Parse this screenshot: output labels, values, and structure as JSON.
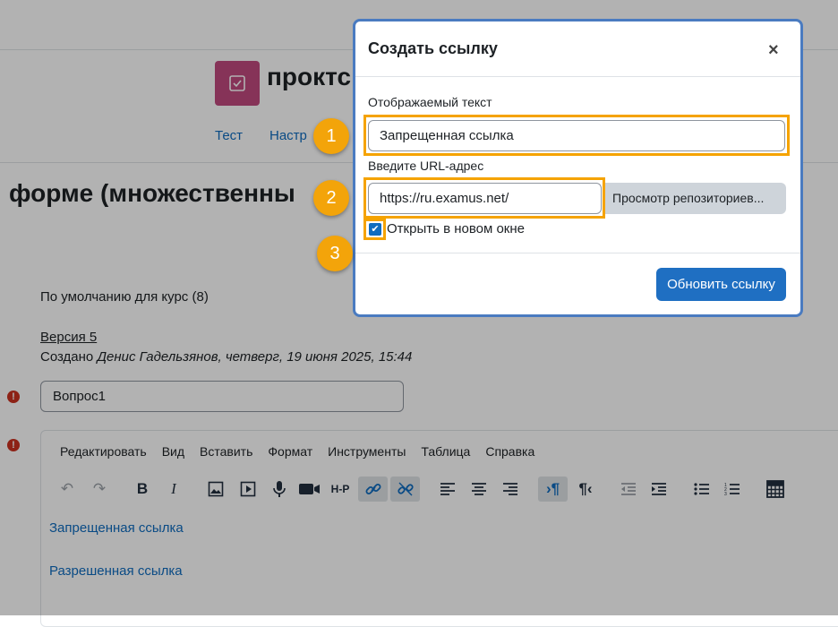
{
  "page": {
    "brand": "проктс",
    "nav": [
      "Тест",
      "Настр"
    ],
    "title": "форме (множественны",
    "category": "По умолчанию для курс (8)",
    "version": "Версия 5",
    "created_prefix": "Создано ",
    "created_by": "Денис Гадельзянов, четверг, 19 июня 2025, 15:44",
    "question_name": "Вопрос1",
    "editor": {
      "menu": [
        "Редактировать",
        "Вид",
        "Вставить",
        "Формат",
        "Инструменты",
        "Таблица",
        "Справка"
      ],
      "content_links": [
        "Запрещенная ссылка",
        "Разрешенная ссылка"
      ]
    }
  },
  "modal": {
    "title": "Создать ссылку",
    "close_glyph": "×",
    "display_text_label": "Отображаемый текст",
    "display_text_value": "Запрещенная ссылка",
    "url_label": "Введите URL-адрес",
    "url_value": "https://ru.examus.net/",
    "browse_label": "Просмотр репозиториев...",
    "new_window_label": "Открыть в новом окне",
    "new_window_checked": true,
    "update_button": "Обновить ссылку"
  },
  "markers": [
    "1",
    "2",
    "3"
  ],
  "colors": {
    "accent": "#0f6cbf",
    "highlight": "#f5a300",
    "marker": "#f3a40a",
    "logo": "#c0497f"
  }
}
